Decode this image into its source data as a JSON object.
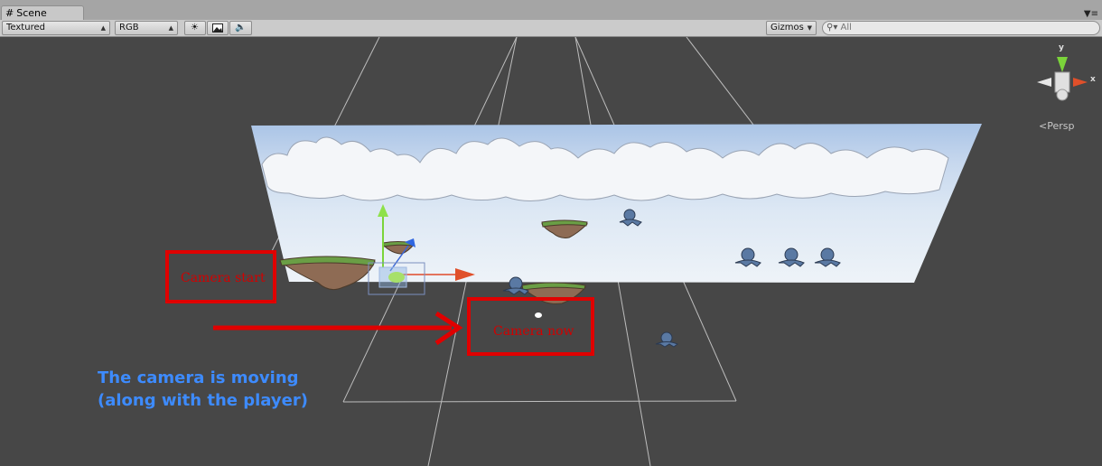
{
  "tab": {
    "label": "Scene",
    "icon": "hash-icon"
  },
  "toolbar": {
    "render_mode": "Textured",
    "color_mode": "RGB",
    "gizmos_label": "Gizmos",
    "search_placeholder": "All"
  },
  "scene": {
    "persp_label": "Persp",
    "axis_y": "y",
    "axis_x": "x",
    "camera_start_label": "Camera start",
    "camera_now_label": "Camera now",
    "caption_line1": "The camera is moving",
    "caption_line2": "(along with the player)"
  },
  "colors": {
    "annotation_red": "#e00000",
    "caption_blue": "#3d8bff",
    "viewport_bg": "#474747"
  }
}
